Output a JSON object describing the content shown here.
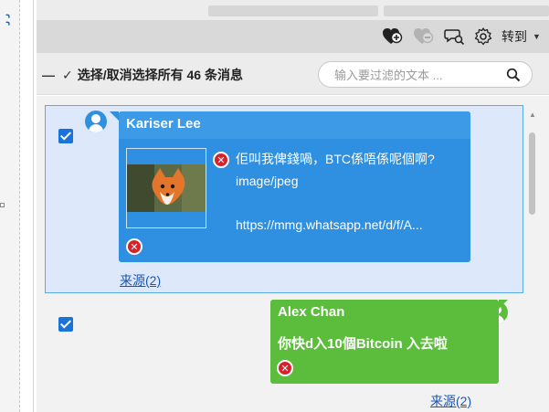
{
  "toolbar": {
    "icons": [
      "heart-plus-icon",
      "heart-minus-icon",
      "chat-search-icon",
      "gear-icon"
    ],
    "goto_label": "转到"
  },
  "selection_bar": {
    "label": "选择/取消选择所有 46 条消息",
    "filter_placeholder": "输入要过滤的文本 ..."
  },
  "messages": [
    {
      "sender": "Kariser Lee",
      "direction": "incoming",
      "checked": true,
      "attachment": {
        "caption": "佢叫我俾錢喎，BTC係唔係呢個啊?",
        "mime": "image/jpeg",
        "url": "https://mmg.whatsapp.net/d/f/A..."
      },
      "source_link": "来源(2)"
    },
    {
      "sender": "Alex Chan",
      "direction": "outgoing",
      "checked": true,
      "text": "你快d入10個Bitcoin 入去啦",
      "source_link": "来源(2)"
    }
  ],
  "colors": {
    "incoming_bubble": "#2f8fe0",
    "outgoing_bubble": "#5cbd3c",
    "selected_row": "#dde8fb",
    "link": "#1a56b8",
    "delete": "#d8222b",
    "checkbox": "#1a73d9"
  }
}
